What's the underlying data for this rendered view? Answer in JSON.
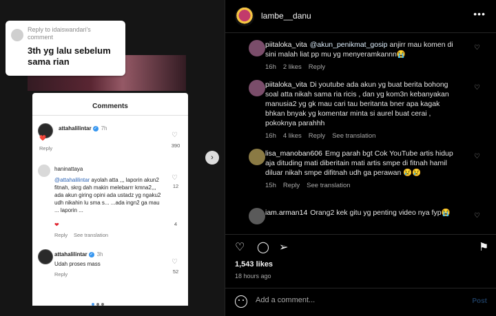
{
  "media": {
    "reply_card": {
      "top_text": "Reply to idaiswandari's comment",
      "text": "3th yg lalu sebelum sama rian"
    },
    "sheet_title": "Comments",
    "comments": [
      {
        "user": "attahalilintar",
        "time": "7h",
        "text": "❤️",
        "reply": "Reply",
        "likes": "390"
      },
      {
        "user": "haninattaya",
        "mention": "@attahalilintar",
        "text": "ayolah atta ,,, laporin akun2 fitnah, skrg dah makin melebarrr kmna2,,, ada akun giring opini ada ustadz yg ngaku2 udh nikahin lu sma s... ...ada ingn2 ga mau ... laporin ...",
        "likes_top": "12",
        "likes_bottom": "4",
        "reply": "Reply",
        "translation": "See translation"
      },
      {
        "user": "attahalilintar",
        "time": "3h",
        "text": "Udah proses mass",
        "reply": "Reply",
        "likes": "52"
      }
    ]
  },
  "header": {
    "username": "lambe__danu",
    "more": "•••"
  },
  "comments": [
    {
      "user": "piitaloka_vita",
      "link": "@akun_penikmat_gosip",
      "text": "anjirr mau komen di sini malah liat pp mu yg menyeramkannn😭",
      "time": "16h",
      "likes": "2 likes",
      "reply": "Reply"
    },
    {
      "user": "piitaloka_vita",
      "text": "Di youtube ada akun yg buat berita bohong soal atta nikah sama ria ricis , dan yg kom3n kebanyakan manusia2 yg gk mau cari tau beritanta bner apa kagak bhkan bnyak yg komentar minta si aurel buat cerai , pokoknya parahhh",
      "time": "16h",
      "likes": "4 likes",
      "reply": "Reply",
      "translation": "See translation"
    },
    {
      "user": "lisa_manoban606",
      "text": "Emg parah bgt Cok YouTube artis hidup aja dituding mati diberitain mati artis smpe di fitnah hamil diluar nikah smpe difitnah udh ga perawan 😢😢",
      "time": "15h",
      "reply": "Reply",
      "translation": "See translation"
    },
    {
      "user": "iam.arman14",
      "text": "Orang2 kek gitu yg penting video nya fyp😭"
    }
  ],
  "likes_text": "1,543 likes",
  "time_ago": "18 hours ago",
  "add_comment": {
    "placeholder": "Add a comment...",
    "post_label": "Post"
  },
  "icons": {
    "heart": "heart-icon",
    "comment": "comment-icon",
    "share": "share-icon",
    "save": "bookmark-icon",
    "emoji": "emoji-icon",
    "next": "chevron-right-icon"
  },
  "colors": {
    "accent": "#3897f0",
    "link": "#e0f1ff",
    "muted": "#a8a8a8"
  }
}
